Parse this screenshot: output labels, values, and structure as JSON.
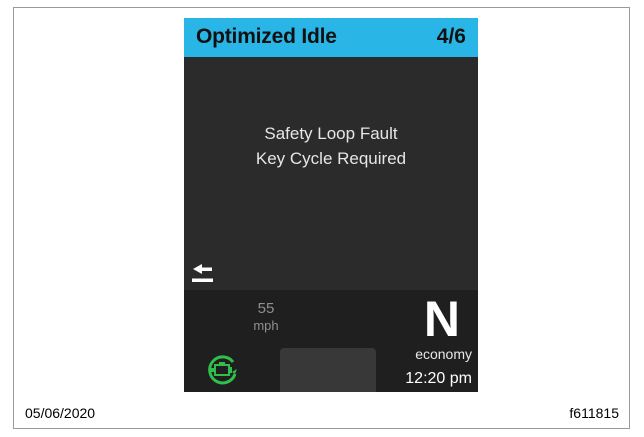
{
  "header": {
    "title": "Optimized Idle",
    "page": "4/6",
    "background": "#29b6e6"
  },
  "message": {
    "line1": "Safety Loop Fault",
    "line2": "Key Cycle Required"
  },
  "status": {
    "speed_value": "55",
    "speed_unit": "mph",
    "gear": "N",
    "mode": "economy",
    "time": "12:20 pm",
    "icons": [
      "back-arrow-icon",
      "engine-warning-icon"
    ],
    "icon_color": "#2fbf4a"
  },
  "footer": {
    "date": "05/06/2020",
    "code": "f611815"
  }
}
